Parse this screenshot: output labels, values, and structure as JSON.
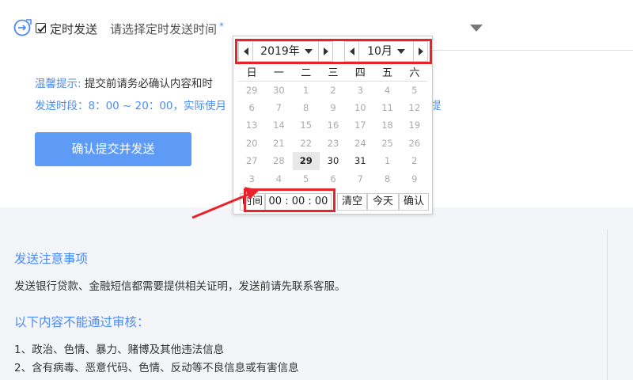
{
  "form": {
    "timer_label": "定时发送",
    "time_placeholder": "请选择定时发送时间",
    "required_mark": "*",
    "tip_key": "温馨提示:",
    "tip_text": "提交前请务必确认内容和时",
    "period_text": "发送时段：8：00 ~ 20：00，实际使月",
    "period_tail": "提",
    "submit_label": "确认提交并发送"
  },
  "notes": {
    "heading": "发送注意事项",
    "body": "发送银行贷款、金融短信都需要提供相关证明，发送前请先联系客服。",
    "reject_heading": "以下内容不能通过审核：",
    "rules": [
      "1、政治、色情、暴力、赌博及其他违法信息",
      "2、含有病毒、恶意代码、色情、反动等不良信息或有害信息"
    ]
  },
  "datepicker": {
    "year": "2019年",
    "month": "10月",
    "weekdays": [
      "日",
      "一",
      "二",
      "三",
      "四",
      "五",
      "六"
    ],
    "weeks": [
      [
        {
          "d": "29",
          "s": "o"
        },
        {
          "d": "30",
          "s": "o"
        },
        {
          "d": "1",
          "s": "o"
        },
        {
          "d": "2",
          "s": "o"
        },
        {
          "d": "3",
          "s": "o"
        },
        {
          "d": "4",
          "s": "o"
        },
        {
          "d": "5",
          "s": "o"
        }
      ],
      [
        {
          "d": "6",
          "s": "o"
        },
        {
          "d": "7",
          "s": "o"
        },
        {
          "d": "8",
          "s": "o"
        },
        {
          "d": "9",
          "s": "o"
        },
        {
          "d": "10",
          "s": "o"
        },
        {
          "d": "11",
          "s": "o"
        },
        {
          "d": "12",
          "s": "o"
        }
      ],
      [
        {
          "d": "13",
          "s": "o"
        },
        {
          "d": "14",
          "s": "o"
        },
        {
          "d": "15",
          "s": "o"
        },
        {
          "d": "16",
          "s": "o"
        },
        {
          "d": "17",
          "s": "o"
        },
        {
          "d": "18",
          "s": "o"
        },
        {
          "d": "19",
          "s": "o"
        }
      ],
      [
        {
          "d": "20",
          "s": "o"
        },
        {
          "d": "21",
          "s": "o"
        },
        {
          "d": "22",
          "s": "o"
        },
        {
          "d": "23",
          "s": "o"
        },
        {
          "d": "24",
          "s": "o"
        },
        {
          "d": "25",
          "s": "o"
        },
        {
          "d": "26",
          "s": "o"
        }
      ],
      [
        {
          "d": "27",
          "s": "o"
        },
        {
          "d": "28",
          "s": "o"
        },
        {
          "d": "29",
          "s": "sel"
        },
        {
          "d": "30",
          "s": "cur"
        },
        {
          "d": "31",
          "s": "cur"
        },
        {
          "d": "1",
          "s": "o"
        },
        {
          "d": "2",
          "s": "o"
        }
      ],
      [
        {
          "d": "3",
          "s": "o"
        },
        {
          "d": "4",
          "s": "o"
        },
        {
          "d": "5",
          "s": "o"
        },
        {
          "d": "6",
          "s": "o"
        },
        {
          "d": "7",
          "s": "o"
        },
        {
          "d": "8",
          "s": "o"
        },
        {
          "d": "9",
          "s": "o"
        }
      ]
    ],
    "time_label": "时间",
    "time_value": "00 : 00 : 00",
    "clear_label": "清空",
    "today_label": "今天",
    "confirm_label": "确认"
  },
  "colors": {
    "accent": "#4a8bf5",
    "button": "#5e9bf7",
    "annotation": "#e8232b"
  }
}
